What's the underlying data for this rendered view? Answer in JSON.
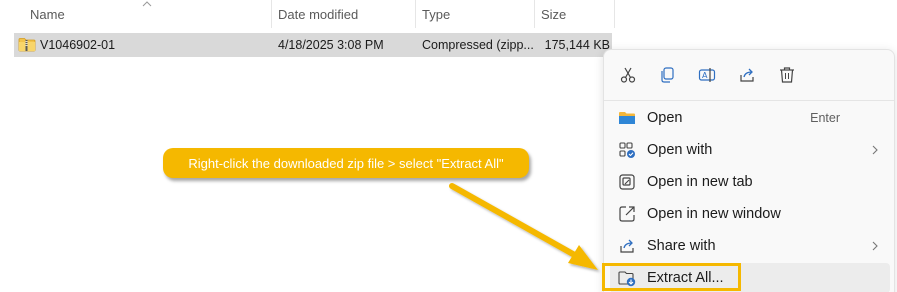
{
  "columns": {
    "name": "Name",
    "date_modified": "Date modified",
    "type": "Type",
    "size": "Size"
  },
  "file": {
    "name": "V1046902-01",
    "date_modified": "4/18/2025 3:08 PM",
    "type": "Compressed (zipp...",
    "size": "175,144 KB"
  },
  "context_menu": {
    "quick_actions": [
      "cut-icon",
      "copy-icon",
      "rename-icon",
      "share-icon",
      "delete-icon"
    ],
    "items": [
      {
        "label": "Open",
        "shortcut": "Enter",
        "icon": "folder-icon",
        "submenu": false
      },
      {
        "label": "Open with",
        "shortcut": "",
        "icon": "open-with-icon",
        "submenu": true
      },
      {
        "label": "Open in new tab",
        "shortcut": "",
        "icon": "new-tab-icon",
        "submenu": false
      },
      {
        "label": "Open in new window",
        "shortcut": "",
        "icon": "new-window-icon",
        "submenu": false
      },
      {
        "label": "Share with",
        "shortcut": "",
        "icon": "share-with-icon",
        "submenu": true
      },
      {
        "label": "Extract All...",
        "shortcut": "",
        "icon": "extract-all-icon",
        "submenu": false
      }
    ]
  },
  "annotation": {
    "text": "Right-click the downloaded zip file > select \"Extract All\"",
    "color": "#f5b800"
  }
}
